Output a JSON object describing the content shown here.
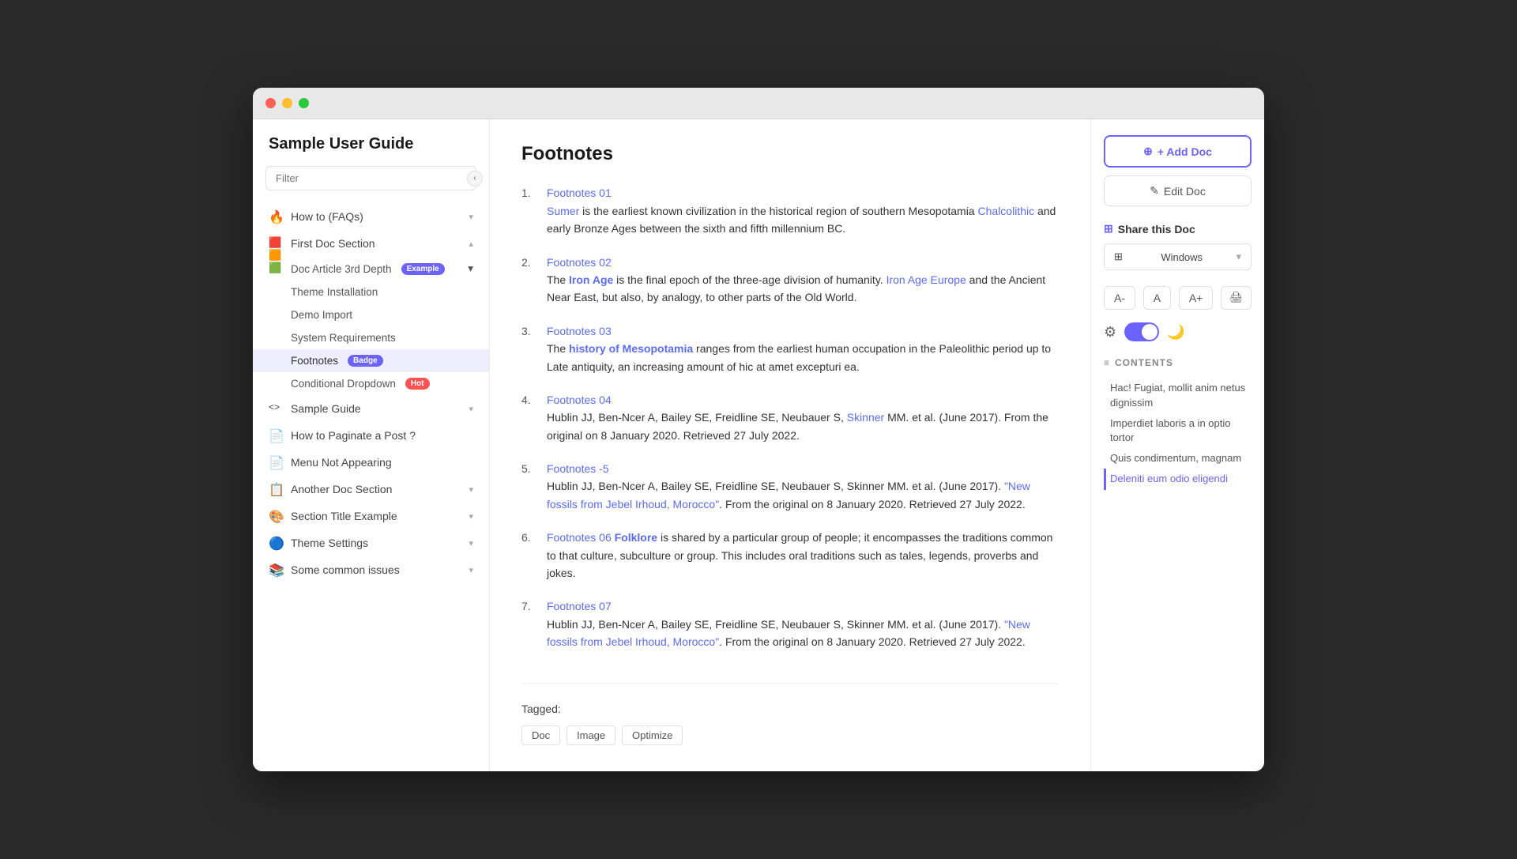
{
  "window": {
    "title": "Sample User Guide"
  },
  "sidebar": {
    "title": "Sample User Guide",
    "filter_placeholder": "Filter",
    "nav_items": [
      {
        "id": "how-to",
        "icon": "🔥",
        "label": "How to (FAQs)",
        "expandable": true,
        "expanded": false
      },
      {
        "id": "first-doc",
        "icon": "🟥🟧🟩",
        "label": "First Doc Section",
        "expandable": true,
        "expanded": true
      },
      {
        "id": "sample-guide",
        "icon": "<>",
        "label": "Sample Guide",
        "expandable": true,
        "expanded": false
      },
      {
        "id": "how-to-paginate",
        "icon": "📄",
        "label": "How to Paginate a Post ?",
        "expandable": false
      },
      {
        "id": "menu-not-appearing",
        "icon": "📄",
        "label": "Menu Not Appearing",
        "expandable": false
      },
      {
        "id": "another-doc",
        "icon": "📋",
        "label": "Another Doc Section",
        "expandable": true,
        "expanded": false
      },
      {
        "id": "section-title",
        "icon": "🎨",
        "label": "Section Title Example",
        "expandable": true,
        "expanded": false
      },
      {
        "id": "theme-settings",
        "icon": "🔵",
        "label": "Theme Settings",
        "expandable": true,
        "expanded": false
      },
      {
        "id": "common-issues",
        "icon": "📚",
        "label": "Some common issues",
        "expandable": true,
        "expanded": false
      }
    ],
    "sub_items": [
      {
        "id": "doc-article",
        "label": "Doc Article 3rd Depth",
        "badge": "Example",
        "badge_type": "example",
        "expandable": true
      },
      {
        "id": "theme-installation",
        "label": "Theme Installation",
        "expandable": false
      },
      {
        "id": "demo-import",
        "label": "Demo Import",
        "expandable": false
      },
      {
        "id": "system-requirements",
        "label": "System Requirements",
        "expandable": false
      },
      {
        "id": "footnotes",
        "label": "Footnotes",
        "badge": "Badge",
        "badge_type": "purple",
        "expandable": false,
        "active": true
      },
      {
        "id": "conditional-dropdown",
        "label": "Conditional Dropdown",
        "badge": "Hot",
        "badge_type": "hot",
        "expandable": false
      }
    ]
  },
  "content": {
    "title": "Footnotes",
    "footnotes": [
      {
        "num": "1.",
        "link_text": "Footnotes 01",
        "body_before": "",
        "highlight_text": "Sumer",
        "highlight_class": "fn-link",
        "body_after": " is the earliest known civilization in the historical region of southern Mesopotamia ",
        "inline_link_text": "Chalcolithic",
        "inline_link_after": " and early Bronze Ages between the sixth and fifth millennium BC."
      },
      {
        "num": "2.",
        "link_text": "Footnotes 02",
        "body_before": "The ",
        "highlight_text": "Iron Age",
        "highlight_class": "fn-link-bold",
        "body_after": " is the final epoch of the three-age division of humanity. ",
        "inline_link_text": "Iron Age Europe",
        "inline_link_after": " and the Ancient Near East, but also, by analogy, to other parts of the Old World."
      },
      {
        "num": "3.",
        "link_text": "Footnotes 03",
        "body_before": "The ",
        "highlight_text": "history of Mesopotamia",
        "highlight_class": "fn-link-bold",
        "body_after": " ranges from the earliest human occupation in the Paleolithic period up to Late antiquity, an increasing amount of hic at amet excepturi ea.",
        "inline_link_text": "",
        "inline_link_after": ""
      },
      {
        "num": "4.",
        "link_text": "Footnotes 04",
        "body_before": "Hublin JJ, Ben-Ncer A, Bailey SE, Freidline SE, Neubauer S, ",
        "highlight_text": "Skinner",
        "highlight_class": "fn-link",
        "body_after": " MM. et al. (June 2017).  From the original on 8 January 2020. Retrieved 27 July 2022.",
        "inline_link_text": "",
        "inline_link_after": ""
      },
      {
        "num": "5.",
        "link_text": "Footnotes -5",
        "body_before": "Hublin JJ, Ben-Ncer A, Bailey SE, Freidline SE, Neubauer S, Skinner MM. et al. (June 2017). ",
        "highlight_text": "\"New fossils from Jebel Irhoud, Morocco\"",
        "highlight_class": "fn-link-quoted",
        "body_after": ". From the original on 8 January 2020. Retrieved 27 July 2022.",
        "inline_link_text": "",
        "inline_link_after": ""
      },
      {
        "num": "6.",
        "link_text": "Footnotes 06",
        "extra_bold": "Folklore",
        "body_before": " is shared by a particular group of people; it encompasses the traditions common to that culture, subculture or group. This includes oral traditions such as tales, legends, proverbs and jokes.",
        "highlight_text": "",
        "highlight_class": "",
        "body_after": "",
        "inline_link_text": "",
        "inline_link_after": ""
      },
      {
        "num": "7.",
        "link_text": "Footnotes 07",
        "body_before": "Hublin JJ, Ben-Ncer A, Bailey SE, Freidline SE, Neubauer S, Skinner MM. et al. (June 2017). ",
        "highlight_text": "\"New fossils from Jebel Irhoud, Morocco\"",
        "highlight_class": "fn-link-quoted",
        "body_after": ". From the original on 8 January 2020. Retrieved 27 July 2022.",
        "inline_link_text": "",
        "inline_link_after": ""
      }
    ],
    "tagged_label": "Tagged:",
    "tags": [
      "Doc",
      "Image",
      "Optimize"
    ]
  },
  "right_panel": {
    "add_doc_label": "+ Add Doc",
    "edit_doc_label": "✎ Edit Doc",
    "share_title": "Share this Doc",
    "os_selected": "Windows",
    "font_smaller": "A-",
    "font_normal": "A",
    "font_larger": "A+",
    "contents_header": "CONTENTS",
    "contents_items": [
      {
        "text": "Hac! Fugiat, mollit anim netus dignissim",
        "active": false
      },
      {
        "text": "Imperdiet laboris a in optio tortor",
        "active": false
      },
      {
        "text": "Quis condimentum, magnam",
        "active": false
      },
      {
        "text": "Deleniti eum odio eligendi",
        "active": true
      }
    ]
  }
}
